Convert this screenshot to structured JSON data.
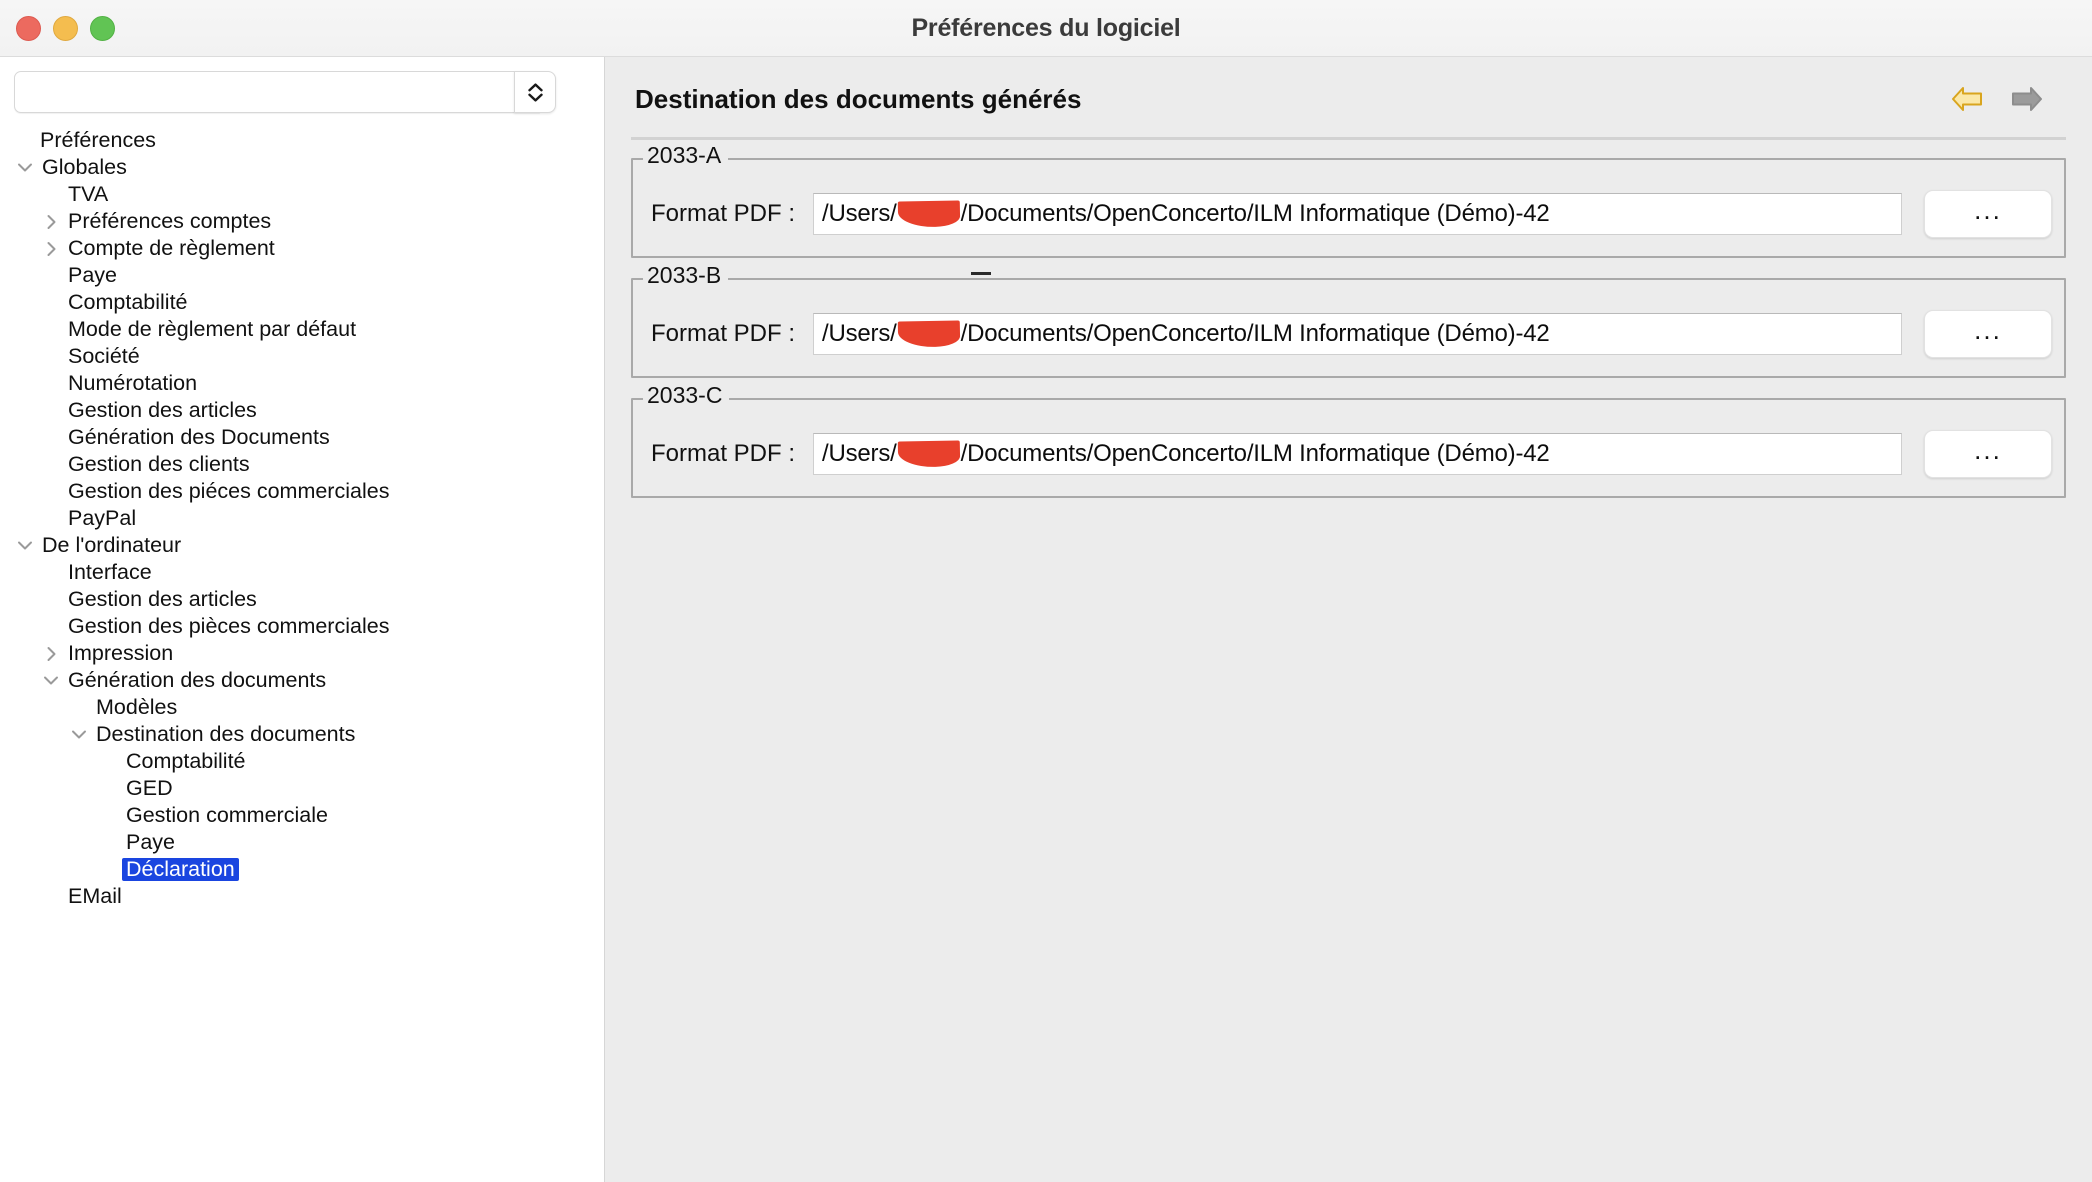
{
  "window": {
    "title": "Préférences du logiciel",
    "traffic_lights": [
      "close-button",
      "minimize-button",
      "maximize-button"
    ]
  },
  "sidebar": {
    "search": {
      "value": "",
      "placeholder": ""
    },
    "tree": [
      {
        "label": "Préférences",
        "level": 0,
        "twist": "none",
        "selected": false
      },
      {
        "label": "Globales",
        "level": 1,
        "twist": "expanded",
        "selected": false
      },
      {
        "label": "TVA",
        "level": 2,
        "twist": "none",
        "selected": false
      },
      {
        "label": "Préférences comptes",
        "level": 2,
        "twist": "collapsed",
        "selected": false
      },
      {
        "label": "Compte de règlement",
        "level": 2,
        "twist": "collapsed",
        "selected": false
      },
      {
        "label": "Paye",
        "level": 2,
        "twist": "none",
        "selected": false
      },
      {
        "label": "Comptabilité",
        "level": 2,
        "twist": "none",
        "selected": false
      },
      {
        "label": "Mode de règlement par défaut",
        "level": 2,
        "twist": "none",
        "selected": false
      },
      {
        "label": "Société",
        "level": 2,
        "twist": "none",
        "selected": false
      },
      {
        "label": "Numérotation",
        "level": 2,
        "twist": "none",
        "selected": false
      },
      {
        "label": "Gestion des articles",
        "level": 2,
        "twist": "none",
        "selected": false
      },
      {
        "label": "Génération des Documents",
        "level": 2,
        "twist": "none",
        "selected": false
      },
      {
        "label": "Gestion des clients",
        "level": 2,
        "twist": "none",
        "selected": false
      },
      {
        "label": "Gestion des piéces commerciales",
        "level": 2,
        "twist": "none",
        "selected": false
      },
      {
        "label": "PayPal",
        "level": 2,
        "twist": "none",
        "selected": false
      },
      {
        "label": "De l'ordinateur",
        "level": 1,
        "twist": "expanded",
        "selected": false
      },
      {
        "label": "Interface",
        "level": 2,
        "twist": "none",
        "selected": false
      },
      {
        "label": "Gestion des articles",
        "level": 2,
        "twist": "none",
        "selected": false
      },
      {
        "label": "Gestion des pièces commerciales",
        "level": 2,
        "twist": "none",
        "selected": false
      },
      {
        "label": "Impression",
        "level": 2,
        "twist": "collapsed",
        "selected": false
      },
      {
        "label": "Génération des documents",
        "level": 2,
        "twist": "expanded",
        "selected": false
      },
      {
        "label": "Modèles",
        "level": 3,
        "twist": "none",
        "selected": false
      },
      {
        "label": "Destination des documents",
        "level": 3,
        "twist": "expanded",
        "selected": false
      },
      {
        "label": "Comptabilité",
        "level": 4,
        "twist": "none",
        "selected": false
      },
      {
        "label": "GED",
        "level": 4,
        "twist": "none",
        "selected": false
      },
      {
        "label": "Gestion commerciale",
        "level": 4,
        "twist": "none",
        "selected": false
      },
      {
        "label": "Paye",
        "level": 4,
        "twist": "none",
        "selected": false
      },
      {
        "label": "Déclaration",
        "level": 4,
        "twist": "none",
        "selected": true
      },
      {
        "label": "EMail",
        "level": 2,
        "twist": "none",
        "selected": false
      }
    ]
  },
  "main": {
    "title": "Destination des documents générés",
    "nav": {
      "back_icon": "arrow-left-icon",
      "back_color": "#f5d98a",
      "forward_icon": "arrow-right-icon",
      "forward_color": "#9a9a9a"
    },
    "groups": [
      {
        "legend": "2033-A",
        "field_label": "Format PDF :",
        "path_prefix": "/Users/",
        "path_suffix": "/Documents/OpenConcerto/ILM Informatique (Démo)-42",
        "redacted": true,
        "browse_label": "..."
      },
      {
        "legend": "2033-B",
        "field_label": "Format PDF :",
        "path_prefix": "/Users/",
        "path_suffix": "/Documents/OpenConcerto/ILM Informatique (Démo)-42",
        "redacted": true,
        "browse_label": "..."
      },
      {
        "legend": "2033-C",
        "field_label": "Format PDF :",
        "path_prefix": "/Users/",
        "path_suffix": "/Documents/OpenConcerto/ILM Informatique (Démo)-42",
        "redacted": true,
        "browse_label": "..."
      }
    ]
  },
  "colors": {
    "selection_blue": "#1a45e0",
    "panel_bg": "#ececec",
    "sidebar_bg": "#ffffff",
    "redaction_red": "#e8402c",
    "group_border": "#a9a9a9"
  }
}
